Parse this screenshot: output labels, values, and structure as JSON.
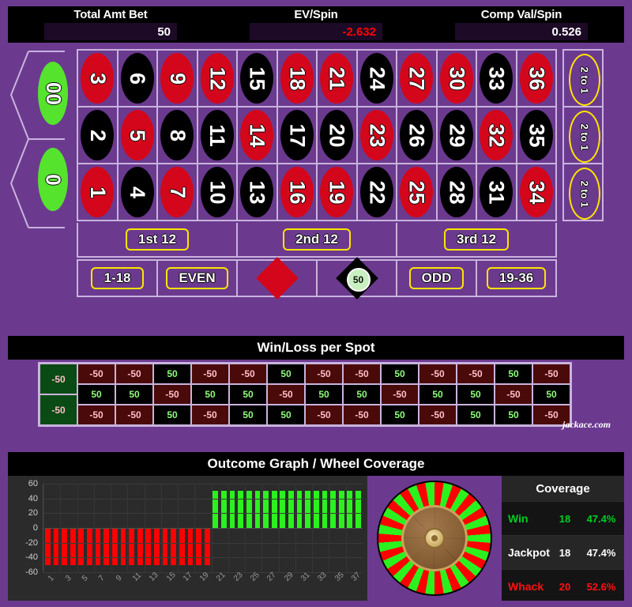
{
  "stats": [
    {
      "label": "Total Amt Bet",
      "value": "50",
      "negative": false
    },
    {
      "label": "EV/Spin",
      "value": "-2.632",
      "negative": true
    },
    {
      "label": "Comp Val/Spin",
      "value": "0.526",
      "negative": false
    }
  ],
  "table": {
    "zeros": [
      {
        "label": "00"
      },
      {
        "label": "0"
      }
    ],
    "numbers": [
      {
        "n": "3",
        "color": "red"
      },
      {
        "n": "6",
        "color": "black"
      },
      {
        "n": "9",
        "color": "red"
      },
      {
        "n": "12",
        "color": "red"
      },
      {
        "n": "15",
        "color": "black"
      },
      {
        "n": "18",
        "color": "red"
      },
      {
        "n": "21",
        "color": "red"
      },
      {
        "n": "24",
        "color": "black"
      },
      {
        "n": "27",
        "color": "red"
      },
      {
        "n": "30",
        "color": "red"
      },
      {
        "n": "33",
        "color": "black"
      },
      {
        "n": "36",
        "color": "red"
      },
      {
        "n": "2",
        "color": "black"
      },
      {
        "n": "5",
        "color": "red"
      },
      {
        "n": "8",
        "color": "black"
      },
      {
        "n": "11",
        "color": "black"
      },
      {
        "n": "14",
        "color": "red"
      },
      {
        "n": "17",
        "color": "black"
      },
      {
        "n": "20",
        "color": "black"
      },
      {
        "n": "23",
        "color": "red"
      },
      {
        "n": "26",
        "color": "black"
      },
      {
        "n": "29",
        "color": "black"
      },
      {
        "n": "32",
        "color": "red"
      },
      {
        "n": "35",
        "color": "black"
      },
      {
        "n": "1",
        "color": "red"
      },
      {
        "n": "4",
        "color": "black"
      },
      {
        "n": "7",
        "color": "red"
      },
      {
        "n": "10",
        "color": "black"
      },
      {
        "n": "13",
        "color": "black"
      },
      {
        "n": "16",
        "color": "red"
      },
      {
        "n": "19",
        "color": "red"
      },
      {
        "n": "22",
        "color": "black"
      },
      {
        "n": "25",
        "color": "red"
      },
      {
        "n": "28",
        "color": "black"
      },
      {
        "n": "31",
        "color": "black"
      },
      {
        "n": "34",
        "color": "red"
      }
    ],
    "column_bets": [
      "2 to 1",
      "2 to 1",
      "2 to 1"
    ],
    "dozens": [
      "1st 12",
      "2nd 12",
      "3rd 12"
    ],
    "outside": [
      {
        "type": "pill",
        "label": "1-18"
      },
      {
        "type": "pill",
        "label": "EVEN"
      },
      {
        "type": "diamond",
        "color": "red",
        "label": ""
      },
      {
        "type": "diamond",
        "color": "black",
        "label": "",
        "chip": "50"
      },
      {
        "type": "pill",
        "label": "ODD"
      },
      {
        "type": "pill",
        "label": "19-36"
      }
    ]
  },
  "winloss": {
    "title": "Win/Loss per Spot",
    "zero_cells": [
      "-50",
      "-50"
    ],
    "rows": [
      [
        "-50",
        "50",
        "-50",
        "-50",
        "50",
        "-50",
        "-50",
        "50",
        "-50",
        "-50",
        "50",
        "-50"
      ],
      [
        "50",
        "-50",
        "50",
        "50",
        "-50",
        "50",
        "50",
        "-50",
        "50",
        "50",
        "-50",
        "50"
      ],
      [
        "-50",
        "50",
        "-50",
        "50",
        "50",
        "-50",
        "-50",
        "50",
        "-50",
        "50",
        "50",
        "-50"
      ]
    ],
    "extra_first_col": [
      "-50",
      "50",
      "-50"
    ],
    "brand": "jackace.com"
  },
  "graph": {
    "title": "Outcome Graph / Wheel Coverage"
  },
  "coverage": {
    "title": "Coverage",
    "rows": [
      {
        "name": "Win",
        "count": "18",
        "pct": "47.4%",
        "style": "c-win"
      },
      {
        "name": "Jackpot",
        "count": "18",
        "pct": "47.4%",
        "style": "c-jack"
      },
      {
        "name": "Whack",
        "count": "20",
        "pct": "52.6%",
        "style": "c-whack"
      }
    ]
  },
  "chart_data": {
    "type": "bar",
    "title": "Outcome Graph / Wheel Coverage",
    "xlabel": "",
    "ylabel": "",
    "ylim": [
      -60,
      60
    ],
    "yticks": [
      60,
      40,
      20,
      0,
      -20,
      -40,
      -60
    ],
    "xticks": [
      "1",
      "3",
      "5",
      "7",
      "9",
      "11",
      "13",
      "15",
      "17",
      "19",
      "21",
      "23",
      "25",
      "27",
      "29",
      "31",
      "33",
      "35",
      "37"
    ],
    "categories": [
      "1",
      "2",
      "3",
      "4",
      "5",
      "6",
      "7",
      "8",
      "9",
      "10",
      "11",
      "12",
      "13",
      "14",
      "15",
      "16",
      "17",
      "18",
      "19",
      "20",
      "21",
      "22",
      "23",
      "24",
      "25",
      "26",
      "27",
      "28",
      "29",
      "30",
      "31",
      "32",
      "33",
      "34",
      "35",
      "36",
      "37",
      "38"
    ],
    "values": [
      -50,
      -50,
      -50,
      -50,
      -50,
      -50,
      -50,
      -50,
      -50,
      -50,
      -50,
      -50,
      -50,
      -50,
      -50,
      -50,
      -50,
      -50,
      -50,
      -50,
      50,
      50,
      50,
      50,
      50,
      50,
      50,
      50,
      50,
      50,
      50,
      50,
      50,
      50,
      50,
      50,
      50,
      50
    ],
    "colors": {
      "positive": "#2bf21e",
      "negative": "#ff0000"
    },
    "grid": true,
    "legend": null
  },
  "colors": {
    "felt": "#6b3a8f",
    "header_bg": "#000000",
    "accent_yellow": "#ffe400",
    "red": "#d4061b",
    "green": "#55e32e"
  }
}
